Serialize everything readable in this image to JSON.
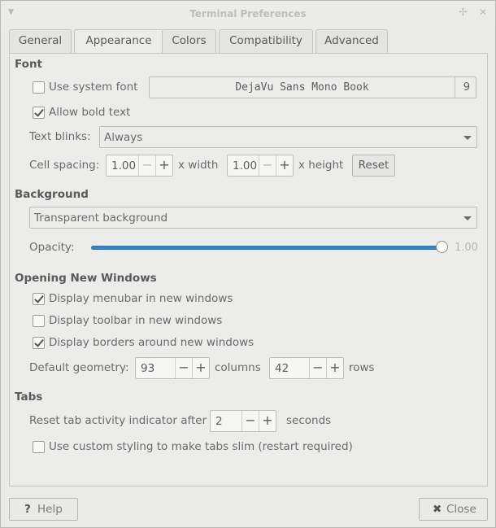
{
  "window": {
    "title": "Terminal Preferences"
  },
  "tabs": [
    {
      "label": "General",
      "active": false
    },
    {
      "label": "Appearance",
      "active": true
    },
    {
      "label": "Colors",
      "active": false
    },
    {
      "label": "Compatibility",
      "active": false
    },
    {
      "label": "Advanced",
      "active": false
    }
  ],
  "font": {
    "heading": "Font",
    "use_system_font": {
      "label": "Use system font",
      "checked": false
    },
    "font_name": "DejaVu Sans Mono Book",
    "font_size": "9",
    "allow_bold": {
      "label": "Allow bold text",
      "checked": true
    },
    "text_blinks_label": "Text blinks:",
    "text_blinks_value": "Always",
    "cell_spacing_label": "Cell spacing:",
    "width_value": "1.00",
    "width_unit": "x width",
    "height_value": "1.00",
    "height_unit": "x height",
    "reset_label": "Reset"
  },
  "background": {
    "heading": "Background",
    "type_value": "Transparent background",
    "opacity_label": "Opacity:",
    "opacity_value": "1.00",
    "opacity_fraction": 1.0
  },
  "windows": {
    "heading": "Opening New Windows",
    "menubar": {
      "label": "Display menubar in new windows",
      "checked": true
    },
    "toolbar": {
      "label": "Display toolbar in new windows",
      "checked": false
    },
    "borders": {
      "label": "Display borders around new windows",
      "checked": true
    },
    "geometry_label": "Default geometry:",
    "columns_value": "93",
    "columns_unit": "columns",
    "rows_value": "42",
    "rows_unit": "rows"
  },
  "tabs_section": {
    "heading": "Tabs",
    "reset_indicator_label": "Reset tab activity indicator after",
    "seconds_value": "2",
    "seconds_unit": "seconds",
    "slim_tabs": {
      "label": "Use custom styling to make tabs slim (restart required)",
      "checked": false
    }
  },
  "footer": {
    "help_label": "Help",
    "close_label": "Close"
  },
  "spin_glyphs": {
    "minus": "−",
    "plus": "+"
  },
  "colors": {
    "accent": "#3d82c4"
  }
}
